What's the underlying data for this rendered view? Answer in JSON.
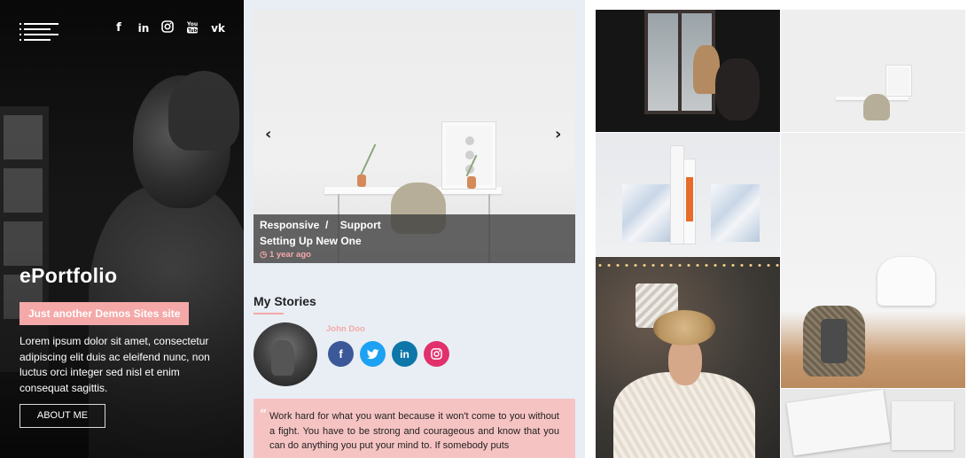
{
  "hero": {
    "menu_icon": "hamburger-icon",
    "social_icons": [
      "facebook-icon",
      "linkedin-icon",
      "instagram-icon",
      "youtube-icon",
      "vk-icon"
    ],
    "title": "ePortfolio",
    "tagline": "Just another Demos Sites site",
    "description": "Lorem ipsum dolor sit amet, consectetur adipiscing elit duis ac eleifend nunc, non luctus orci integer sed nisl et enim consequat sagittis.",
    "button_label": "ABOUT ME"
  },
  "slider": {
    "prev_arrow": "‹",
    "next_arrow": "›",
    "categories": [
      "Responsive",
      "Support"
    ],
    "separator": "/",
    "post_title": "Setting Up New One",
    "time_ago": "1 year ago",
    "time_icon": "clock-icon"
  },
  "stories": {
    "heading": "My Stories",
    "author": "John Doo",
    "socials": [
      {
        "name": "facebook",
        "glyph": "f",
        "color": "#3b5998"
      },
      {
        "name": "twitter",
        "glyph": "t",
        "color": "#1da1f2"
      },
      {
        "name": "linkedin",
        "glyph": "in",
        "color": "#0e76a8"
      },
      {
        "name": "instagram",
        "glyph": "ig",
        "color": "#e1306c"
      }
    ],
    "quote_mark": "“",
    "quote": "Work hard for what you want because it won't come to you without a fight. You have to be strong and courageous and know that you can do anything you put your mind to. If somebody puts"
  },
  "colors": {
    "accent_pink": "#f5a8a8",
    "quote_bg": "#f6c3c3",
    "middle_bg": "#e8eef4"
  }
}
